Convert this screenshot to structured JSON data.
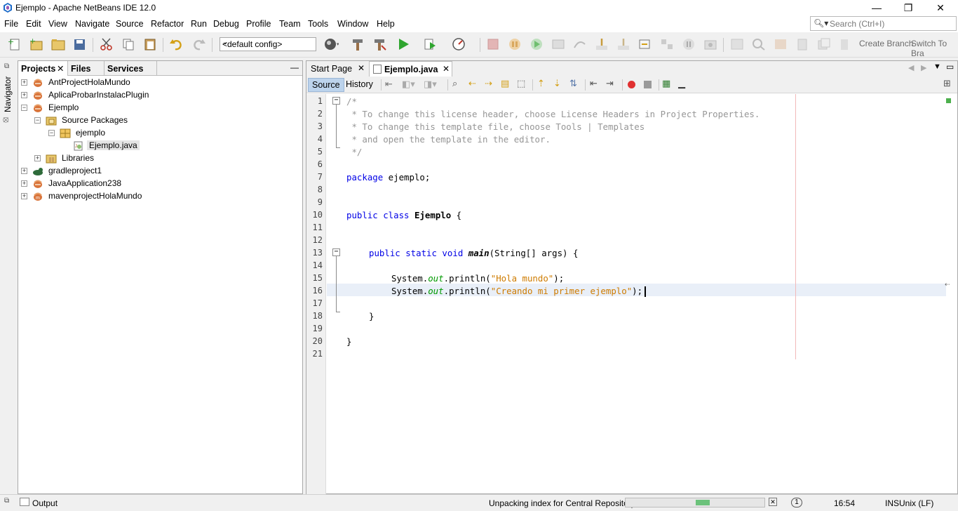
{
  "window": {
    "title": "Ejemplo - Apache NetBeans IDE 12.0",
    "minimize": "—",
    "maximize": "❐",
    "close": "✕"
  },
  "menu": [
    "File",
    "Edit",
    "View",
    "Navigate",
    "Source",
    "Refactor",
    "Run",
    "Debug",
    "Profile",
    "Team",
    "Tools",
    "Window",
    "Help"
  ],
  "search": {
    "placeholder": "Search (Ctrl+I)"
  },
  "toolbar": {
    "config": "<default config>",
    "create_branch": "Create Branch",
    "switch_to_branch": "Switch To Bra"
  },
  "left_strip": {
    "navigator": "Navigator"
  },
  "projects_panel": {
    "tabs": [
      "Projects",
      "Files",
      "Services"
    ],
    "tree": [
      {
        "label": "AntProjectHolaMundo",
        "level": 0,
        "icon": "ant-project-icon",
        "expander": "+"
      },
      {
        "label": "AplicaProbarInstalacPlugin",
        "level": 0,
        "icon": "ant-project-icon",
        "expander": "+"
      },
      {
        "label": "Ejemplo",
        "level": 0,
        "icon": "ant-project-icon",
        "expander": "−"
      },
      {
        "label": "Source Packages",
        "level": 1,
        "icon": "source-packages-icon",
        "expander": "−"
      },
      {
        "label": "ejemplo",
        "level": 2,
        "icon": "package-icon",
        "expander": "−"
      },
      {
        "label": "Ejemplo.java",
        "level": 3,
        "icon": "java-file-icon",
        "expander": "",
        "selected": true
      },
      {
        "label": "Libraries",
        "level": 1,
        "icon": "libraries-icon",
        "expander": "+"
      },
      {
        "label": "gradleproject1",
        "level": 0,
        "icon": "gradle-project-icon",
        "expander": "+"
      },
      {
        "label": "JavaApplication238",
        "level": 0,
        "icon": "ant-project-icon",
        "expander": "+"
      },
      {
        "label": "mavenprojectHolaMundo",
        "level": 0,
        "icon": "maven-project-icon",
        "expander": "+"
      }
    ]
  },
  "editor": {
    "tabs": [
      {
        "label": "Start Page",
        "active": false
      },
      {
        "label": "Ejemplo.java",
        "active": true
      }
    ],
    "source_label": "Source",
    "history_label": "History",
    "line_numbers": [
      "1",
      "2",
      "3",
      "4",
      "5",
      "6",
      "7",
      "8",
      "9",
      "10",
      "11",
      "12",
      "13",
      "14",
      "15",
      "16",
      "17",
      "18",
      "19",
      "20",
      "21"
    ],
    "code": {
      "l1": "/*",
      "l2": " * To change this license header, choose License Headers in Project Properties.",
      "l3": " * To change this template file, choose Tools | Templates",
      "l4": " * and open the template in the editor.",
      "l5": " */",
      "l7_kw": "package",
      "l7_rest": " ejemplo;",
      "l10_kw": "public class",
      "l10_name": " Ejemplo",
      "l10_rest": " {",
      "l13_kw": "public static void",
      "l13_name": "main",
      "l13_rest": "(String[] args) {",
      "l15_a": "System.",
      "l15_field": "out",
      "l15_b": ".println(",
      "l15_str": "\"Hola mundo\"",
      "l15_c": ");",
      "l16_a": "System.",
      "l16_field": "out",
      "l16_b": ".println(",
      "l16_str": "\"Creando mi primer ejemplo\"",
      "l16_c": ");",
      "l18": "}",
      "l20": "}"
    }
  },
  "status": {
    "output_label": "Output",
    "message": "Unpacking index for Central Repository",
    "progress": 0.1,
    "notification": "1",
    "caret": "16:54",
    "insert_mode": "INS",
    "line_endings": "Unix (LF)"
  },
  "colors": {
    "keyword": "#0000e6",
    "comment": "#969696",
    "string": "#ce7b00",
    "field": "#009900",
    "current_line": "#e9eff8",
    "progress_fill": "#6cc27b"
  }
}
